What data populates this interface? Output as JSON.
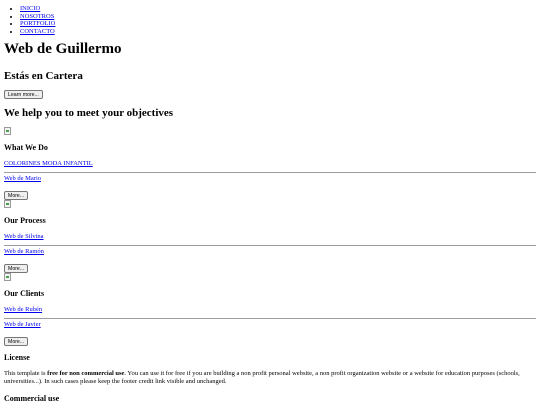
{
  "nav": {
    "items": [
      "INICIO",
      "NOSOTROS",
      "PORTFOLIO",
      "CONTACTO"
    ]
  },
  "header": {
    "site_title": "Web de Guillermo",
    "subtitle": "Estás en Cartera",
    "learn_more": "Learn more..."
  },
  "intro": {
    "heading": "We help you to meet your objectives"
  },
  "sections": [
    {
      "title": "What We Do",
      "link1": "COLORINES MODA INFANTIL",
      "link2": "Web de Mario",
      "more": "More..."
    },
    {
      "title": "Our Process",
      "link1": "Web de Silvina",
      "link2": "Web de Ramón",
      "more": "More..."
    },
    {
      "title": "Our Clients",
      "link1": "Web de Rubén",
      "link2": "Web de Javier",
      "more": "More..."
    }
  ],
  "license": {
    "title": "License",
    "text_before": "This template is ",
    "text_bold": "free for non commercial use",
    "text_after": ". You can use it for free if you are building a non profit personal website, a non profit organization website or a website for education purposes (schools, universities...). In such cases please keep the footer credit link visible and unchanged.",
    "commercial_title": "Commercial use"
  }
}
